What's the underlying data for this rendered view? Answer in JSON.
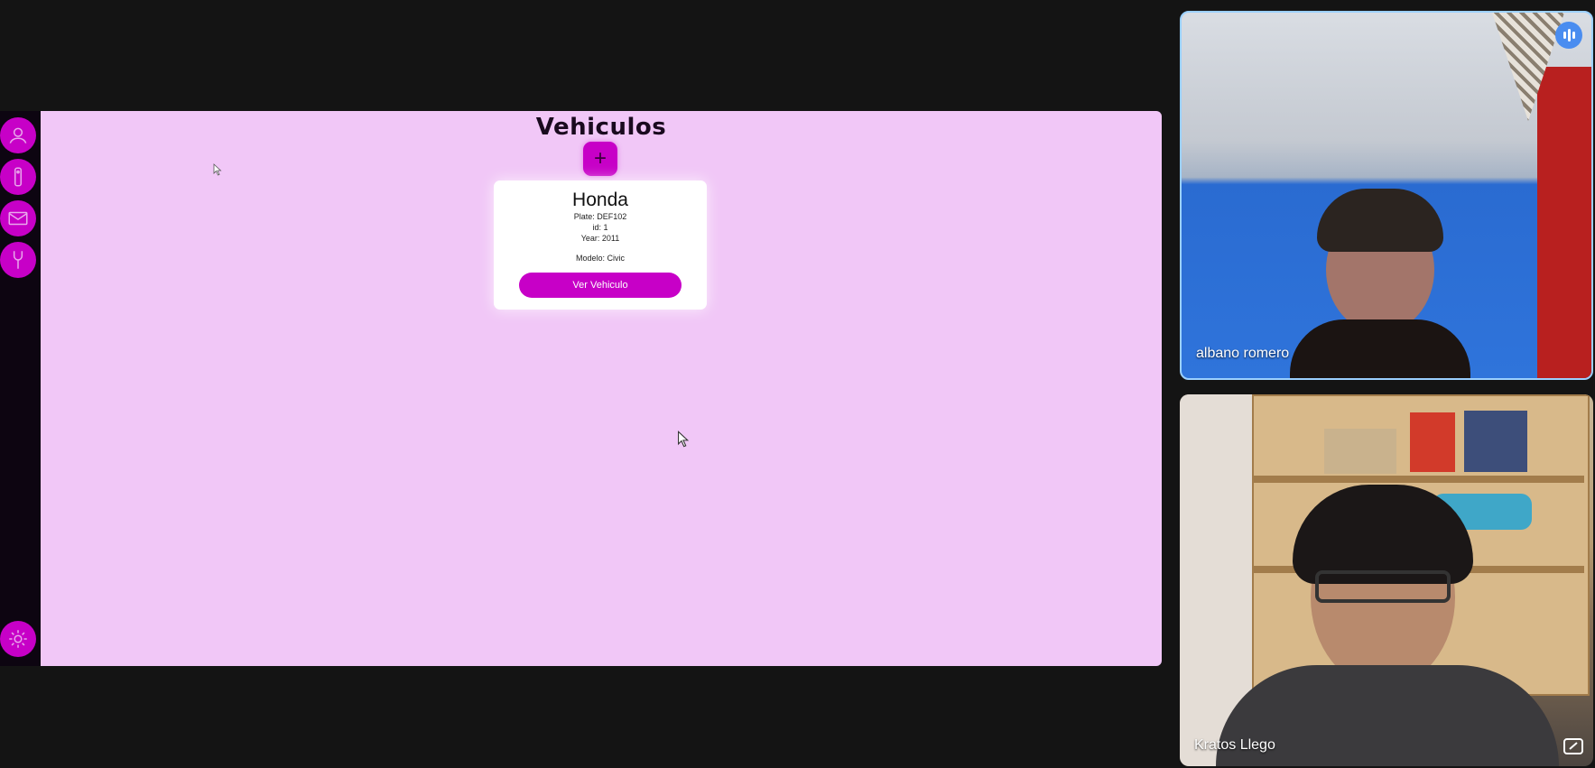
{
  "app": {
    "page_title": "Vehiculos",
    "add_button_label": "+",
    "sidebar_icons": [
      "user-icon",
      "tag-icon",
      "mail-icon",
      "wrench-icon",
      "gear-icon"
    ]
  },
  "vehicle_card": {
    "brand": "Honda",
    "plate": "Plate: DEF102",
    "id": "id: 1",
    "year": "Year: 2011",
    "model": "Modelo: Civic",
    "button_label": "Ver Vehiculo"
  },
  "participants": [
    {
      "name": "albano romero",
      "speaking": true
    },
    {
      "name": "Kratos Llego",
      "speaking": false
    }
  ],
  "colors": {
    "accent": "#c700c7",
    "content_bg": "#f1c7f7",
    "rail_bg": "#0d0511",
    "page_bg": "#141414"
  }
}
